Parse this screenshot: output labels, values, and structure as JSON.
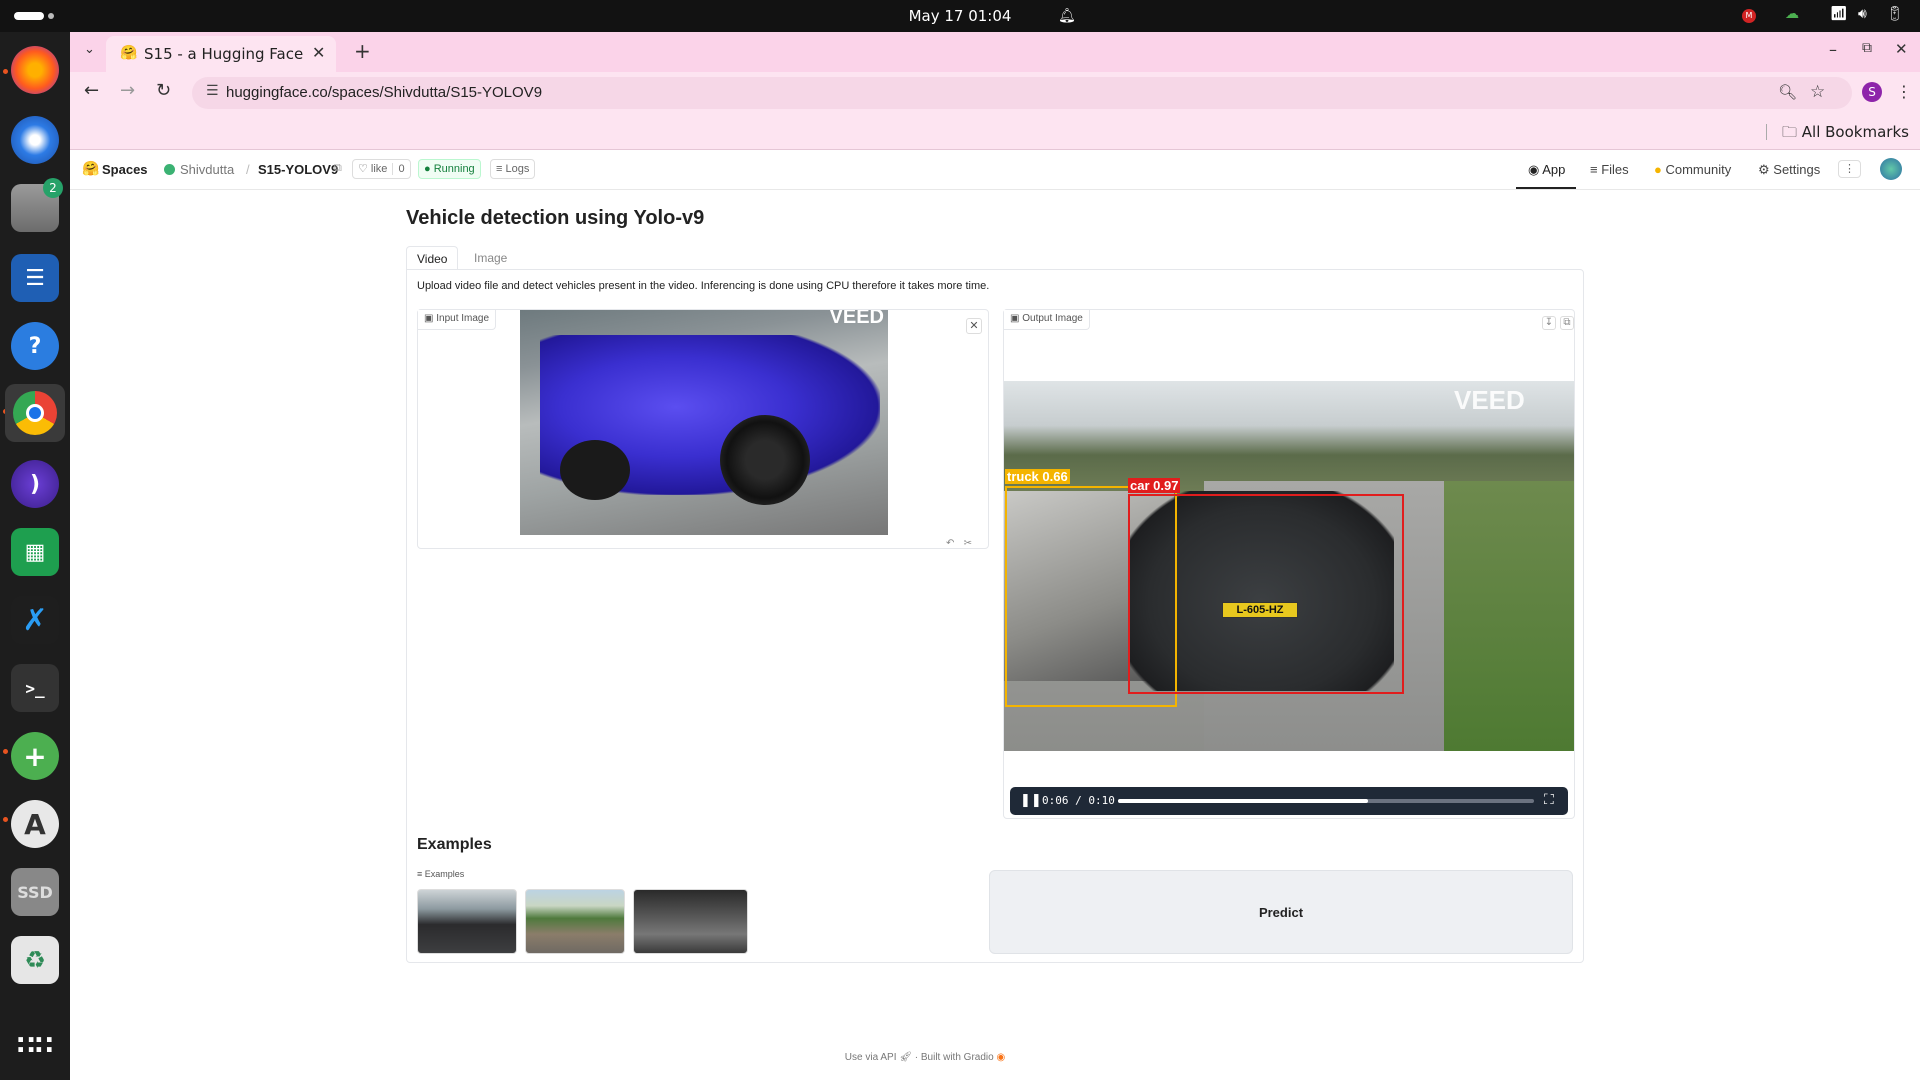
{
  "system": {
    "clock": "May 17  01:04",
    "dock": {
      "files_badge": "2",
      "ssd_label": "SSD"
    }
  },
  "browser": {
    "tab_title": "S15 - a Hugging Face Space",
    "url": "huggingface.co/spaces/Shivdutta/S15-YOLOV9",
    "bookmarks_label": "All Bookmarks",
    "profile_initial": "S"
  },
  "hf": {
    "spaces_label": "Spaces",
    "owner": "Shivdutta",
    "repo": "S15-YOLOV9",
    "like_label": "like",
    "like_count": "0",
    "status": "Running",
    "logs_label": "Logs",
    "nav": {
      "app": "App",
      "files": "Files",
      "community": "Community",
      "settings": "Settings"
    }
  },
  "app": {
    "title": "Vehicle detection using Yolo-v9",
    "tabs": [
      "Video",
      "Image"
    ],
    "description": "Upload video file and detect vehicles present in the video. Inferencing is done using CPU therefore it takes more time.",
    "input_label": "Input Image",
    "output_label": "Output Image",
    "watermark": "VEED",
    "plate_text": "L-605-HZ",
    "detections": [
      {
        "label": "truck  0.66",
        "color": "#f4b400"
      },
      {
        "label": "car  0.97",
        "color": "#e11d1d"
      }
    ],
    "video": {
      "time": "0:06 / 0:10",
      "progress_fraction": 0.6
    },
    "examples_title": "Examples",
    "examples_label": "Examples",
    "predict_label": "Predict"
  },
  "footer": {
    "api": "Use via API",
    "built": "Built with Gradio",
    "separator": "·"
  }
}
